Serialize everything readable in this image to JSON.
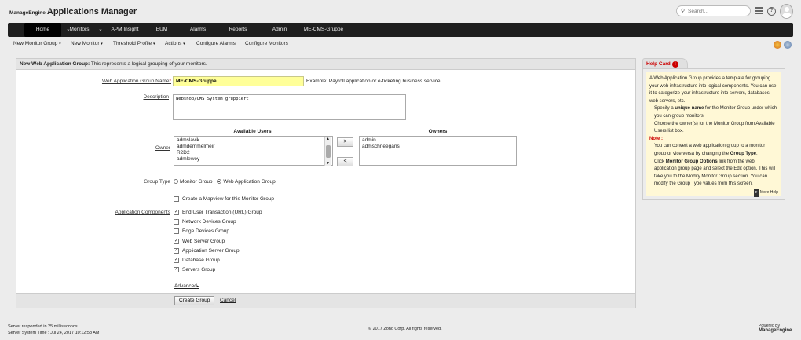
{
  "header": {
    "brand": "ManageEngine",
    "app_name": "Applications Manager",
    "search_placeholder": "Search..."
  },
  "topnav": {
    "items": [
      "Home",
      "Monitors",
      "APM Insight",
      "EUM",
      "Alarms",
      "Reports",
      "Admin",
      "ME-CMS-Gruppe"
    ]
  },
  "subnav": {
    "items": [
      "New Monitor Group",
      "New Monitor",
      "Threshold Profile",
      "Actions",
      "Configure Alarms",
      "Configure Monitors"
    ]
  },
  "form": {
    "title_bold": "New Web Application Group:",
    "title_rest": " This represents a logical grouping of your monitors.",
    "name_label": "Web Application Group Name",
    "name_value": "ME-CMS-Gruppe",
    "name_example": "Example: Payroll application or e-ticketing business service",
    "desc_label": "Description",
    "desc_value": "Webshop/CMS System gruppiert",
    "owner_label": "Owner",
    "available_users_head": "Available Users",
    "available_users": [
      "admslavik",
      "admdemmelmeir",
      "R2D2",
      "admlewey"
    ],
    "owners_head": "Owners",
    "owners": [
      "admin",
      "admschneegans"
    ],
    "move_right": ">",
    "move_left": "<",
    "group_type_label": "Group Type",
    "group_type_options": [
      "Monitor Group",
      "Web Application Group"
    ],
    "group_type_selected": "Web Application Group",
    "mapview_label": "Create a Mapview for this Monitor Group",
    "components_label": "Application Components",
    "components": [
      {
        "label": "End User Transaction (URL) Group",
        "checked": true
      },
      {
        "label": "Network Devices Group",
        "checked": false
      },
      {
        "label": "Edge Devices Group",
        "checked": false
      },
      {
        "label": "Web Server Group",
        "checked": true
      },
      {
        "label": "Application Server Group",
        "checked": true
      },
      {
        "label": "Database Group",
        "checked": true
      },
      {
        "label": "Servers Group",
        "checked": true
      }
    ],
    "advanced_label": "Advanced",
    "create_button": "Create Group",
    "cancel_link": "Cancel"
  },
  "help_card": {
    "tab_label": "Help Card",
    "intro": "A Web Application Group provides a template for grouping your web infrastructure into logical components. You can use it to categorize your infrastructure into servers, databases, web servers, etc.",
    "line1_pre": "Specify a ",
    "line1_bold": "unique name",
    "line1_post": " for the Monitor Group under which you can group monitors.",
    "line2": "Choose the owner(s) for the Monitor Group from Available Users list box.",
    "note_label": "Note :",
    "line3_pre": "You can convert a web application group to a monitor group or vice versa by changing the ",
    "line3_bold": "Group Type",
    "line3_post": ".",
    "line4_pre": "Click ",
    "line4_bold": "Monitor Group Options",
    "line4_post": " link from the web application group page and select the Edit option. This will take you to the Modify Monitor Group section. You can modify the Group Type values from this screen.",
    "more_help": "More Help"
  },
  "footer": {
    "response": "Server responded in 25 milliseconds",
    "system_time": "Server System Time : Jul 24, 2017 10:12:58 AM",
    "copyright": "© 2017 Zoho Corp.   All rights reserved.",
    "powered_by": "Powered By",
    "powered_brand": "ManageEngine"
  },
  "colors": {
    "nav_bg": "#1f1f1f",
    "name_field_bg": "#ffff99",
    "help_card_bg": "#fff8d6",
    "accent_red": "#cc0000"
  }
}
